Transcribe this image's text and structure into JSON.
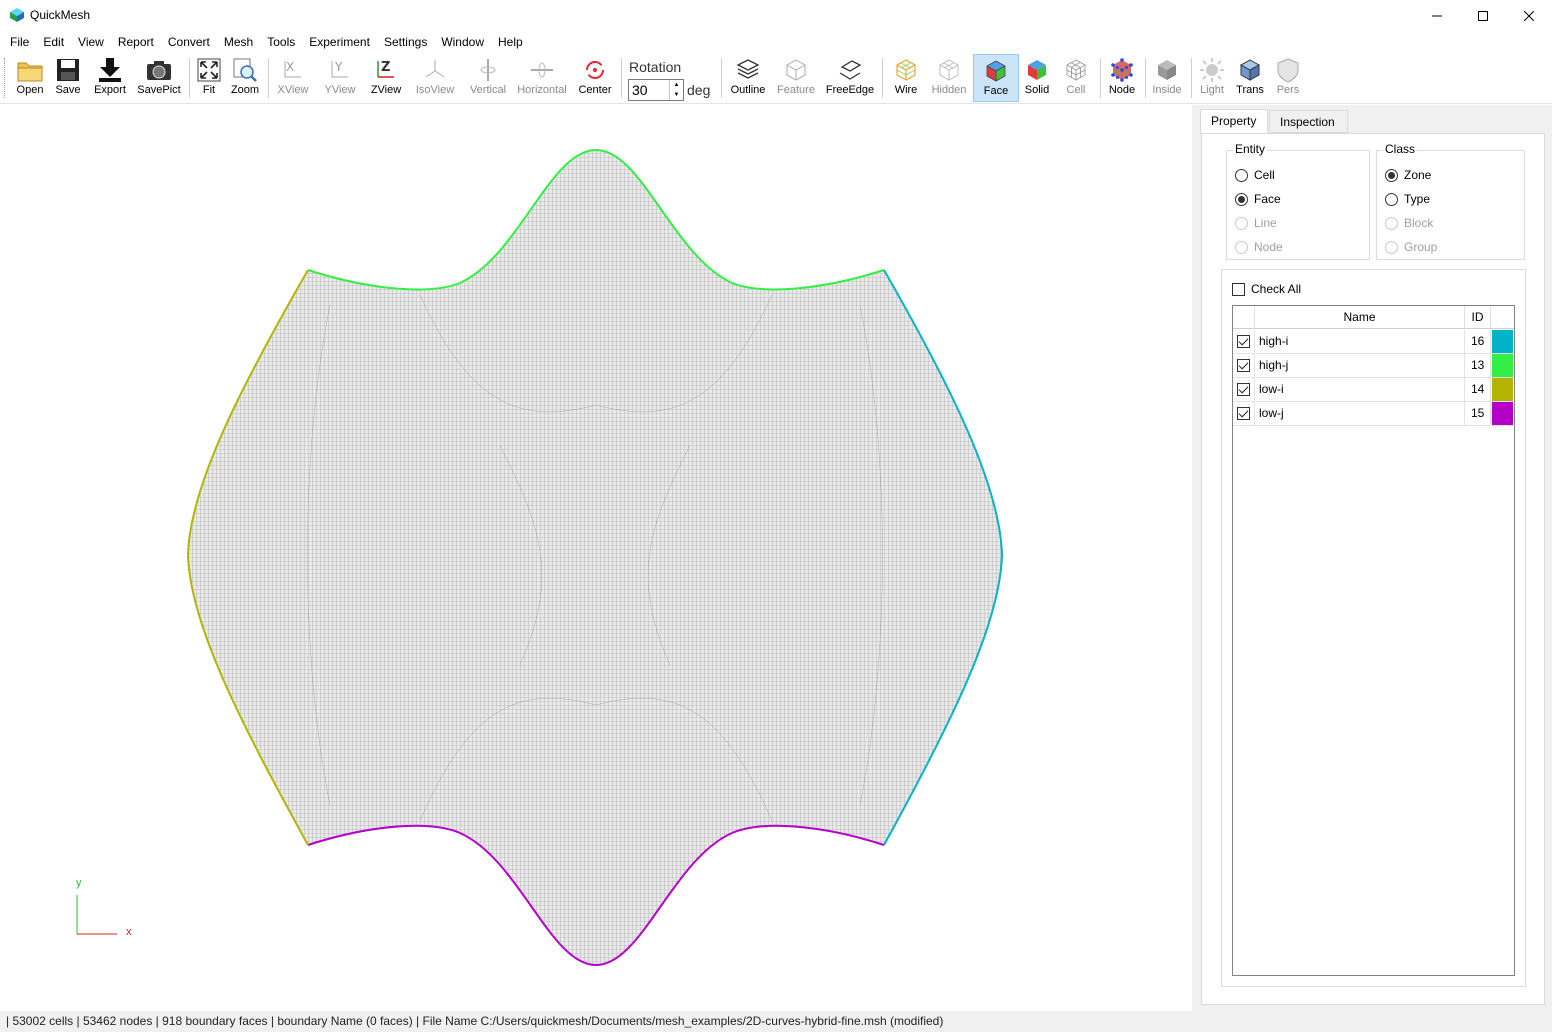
{
  "window": {
    "title": "QuickMesh"
  },
  "menu": [
    "File",
    "Edit",
    "View",
    "Report",
    "Convert",
    "Mesh",
    "Tools",
    "Experiment",
    "Settings",
    "Window",
    "Help"
  ],
  "toolbar": {
    "open": "Open",
    "save": "Save",
    "export": "Export",
    "savepict": "SavePict",
    "fit": "Fit",
    "zoom": "Zoom",
    "xview": "XView",
    "yview": "YView",
    "zview": "ZView",
    "isoview": "IsoView",
    "vertical": "Vertical",
    "horizontal": "Horizontal",
    "center": "Center",
    "rotation_label": "Rotation",
    "rotation_value": "30",
    "rotation_unit": "deg",
    "outline": "Outline",
    "feature": "Feature",
    "freeedge": "FreeEdge",
    "wire": "Wire",
    "hidden": "Hidden",
    "face": "Face",
    "solid": "Solid",
    "cell": "Cell",
    "node": "Node",
    "inside": "Inside",
    "light": "Light",
    "trans": "Trans",
    "pers": "Pers"
  },
  "viewport": {
    "axis_y": "y",
    "axis_x": "x",
    "boundary_colors": {
      "high_i": "#00b4c8",
      "high_j": "#33ee44",
      "low_i": "#b4b400",
      "low_j": "#b400c8"
    }
  },
  "panel": {
    "tabs": [
      "Property",
      "Inspection"
    ],
    "active_tab": "Property",
    "entity": {
      "title": "Entity",
      "options": [
        {
          "label": "Cell",
          "checked": false,
          "enabled": true
        },
        {
          "label": "Face",
          "checked": true,
          "enabled": true
        },
        {
          "label": "Line",
          "checked": false,
          "enabled": false
        },
        {
          "label": "Node",
          "checked": false,
          "enabled": false
        }
      ]
    },
    "class": {
      "title": "Class",
      "options": [
        {
          "label": "Zone",
          "checked": true,
          "enabled": true
        },
        {
          "label": "Type",
          "checked": false,
          "enabled": true
        },
        {
          "label": "Block",
          "checked": false,
          "enabled": false
        },
        {
          "label": "Group",
          "checked": false,
          "enabled": false
        }
      ]
    },
    "check_all": "Check All",
    "grid": {
      "headers": {
        "name": "Name",
        "id": "ID"
      },
      "rows": [
        {
          "name": "high-i",
          "id": "16",
          "color": "#00b4c8",
          "checked": true
        },
        {
          "name": "high-j",
          "id": "13",
          "color": "#33ee44",
          "checked": true
        },
        {
          "name": "low-i",
          "id": "14",
          "color": "#b4b400",
          "checked": true
        },
        {
          "name": "low-j",
          "id": "15",
          "color": "#b400c8",
          "checked": true
        }
      ]
    }
  },
  "status": "| 53002 cells | 53462 nodes | 918 boundary faces |  boundary Name  (0 faces) | File Name C:/Users/quickmesh/Documents/mesh_examples/2D-curves-hybrid-fine.msh (modified)"
}
